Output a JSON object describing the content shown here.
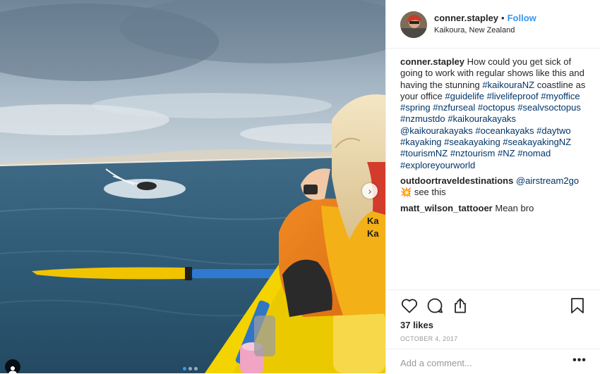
{
  "post": {
    "username": "conner.stapley",
    "follow_label": "Follow",
    "separator": "•",
    "location": "Kaikoura, New Zealand"
  },
  "caption": {
    "username": "conner.stapley",
    "text_parts": [
      "How could you get sick of going to work with regular shows like this and having the stunning ",
      "#kaikouraNZ",
      " coastline as your office ",
      "#guidelife",
      " ",
      "#livelifeproof",
      " ",
      "#myoffice",
      " ",
      "#spring",
      " ",
      "#nzfurseal",
      " ",
      "#octopus",
      " ",
      "#sealvsoctopus",
      " ",
      "#nzmustdo",
      " ",
      "#kaikourakayaks",
      " ",
      "@kaikourakayaks",
      " ",
      "#oceankayaks",
      " ",
      "#daytwo",
      " ",
      "#kayaking",
      " ",
      "#seakayaking",
      " ",
      "#seakayakingNZ",
      " ",
      "#tourismNZ",
      " ",
      "#nztourism",
      " ",
      "#NZ",
      " ",
      "#nomad",
      " ",
      "#exploreyourworld"
    ]
  },
  "comments": [
    {
      "username": "outdoortraveldestinations",
      "mention": "@airstream2go",
      "emoji": "💥",
      "text": "see this"
    },
    {
      "username": "matt_wilson_tattooer",
      "text": "Mean bro"
    }
  ],
  "stats": {
    "likes": "37 likes",
    "date": "OCTOBER 4, 2017"
  },
  "add_comment": {
    "placeholder": "Add a comment...",
    "more_label": "•••"
  },
  "icons": {
    "like": "heart-icon",
    "comment": "comment-icon",
    "share": "share-icon",
    "save": "bookmark-icon",
    "next": "chevron-right-icon",
    "tag": "person-tag-icon"
  },
  "carousel": {
    "slides": 3,
    "active_index": 0
  },
  "colors": {
    "link_blue": "#3897f0",
    "hashtag": "#003569",
    "muted": "#999999",
    "text": "#262626",
    "border": "#efefef"
  }
}
